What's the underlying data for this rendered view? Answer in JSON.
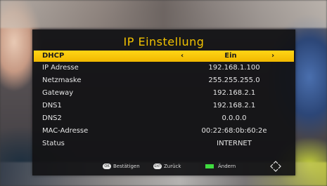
{
  "title": "IP Einstellung",
  "rows": [
    {
      "label": "DHCP",
      "value": "Ein",
      "left_arrow": "‹",
      "right_arrow": "›"
    },
    {
      "label": "IP Adresse",
      "value": "192.168.1.100"
    },
    {
      "label": "Netzmaske",
      "value": "255.255.255.0"
    },
    {
      "label": "Gateway",
      "value": "192.168.2.1"
    },
    {
      "label": "DNS1",
      "value": "192.168.2.1"
    },
    {
      "label": "DNS2",
      "value": "0.0.0.0"
    },
    {
      "label": "MAC-Adresse",
      "value": "00:22:68:0b:60:2e"
    },
    {
      "label": "Status",
      "value": "INTERNET"
    }
  ],
  "footer": {
    "confirm_key": "OK",
    "confirm_label": "Bestätigen",
    "back_key": "EXIT",
    "back_label": "Zurück",
    "change_label": "Ändern",
    "change_color": "#3fdc3f"
  },
  "colors": {
    "accent": "#f2c200",
    "highlight": "#ffd516"
  },
  "icons": [
    "ok-button-icon",
    "exit-button-icon",
    "green-key-icon",
    "nav-arrows-icon"
  ]
}
